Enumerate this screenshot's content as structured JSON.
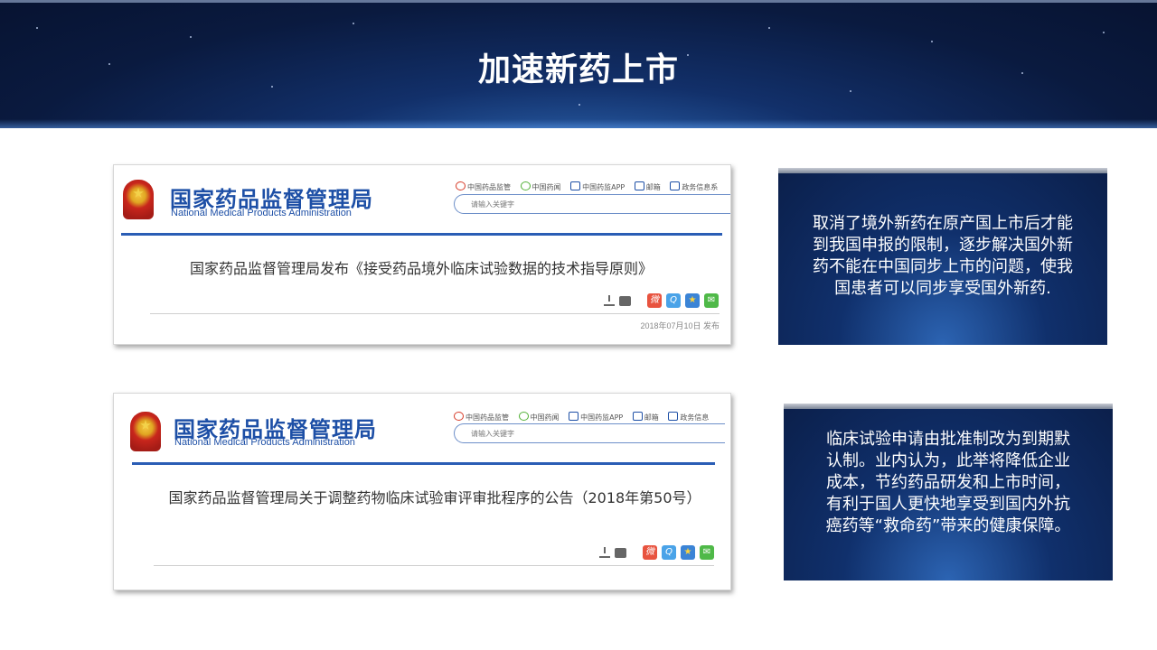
{
  "slide": {
    "title": "加速新药上市"
  },
  "cards": [
    {
      "org_cn": "国家药品监督管理局",
      "org_en": "National Medical Products Administration",
      "links": [
        "中国药品监管",
        "中国药闻",
        "中国药监APP",
        "邮箱",
        "政务信息系"
      ],
      "search_placeholder": "请输入关键字",
      "headline": "国家药品监督管理局发布《接受药品境外临床试验数据的技术指导原则》",
      "date": "2018年07月10日 发布"
    },
    {
      "org_cn": "国家药品监督管理局",
      "org_en": "National Medical Products Administration",
      "links": [
        "中国药品监管",
        "中国药闻",
        "中国药监APP",
        "邮箱",
        "政务信息"
      ],
      "search_placeholder": "请输入关键字",
      "headline": "国家药品监督管理局关于调整药物临床试验审评审批程序的公告（2018年第50号）"
    }
  ],
  "info_boxes": [
    {
      "text": "取消了境外新药在原产国上市后才能到我国申报的限制，逐步解决国外新药不能在中国同步上市的问题，使我国患者可以同步享受国外新药."
    },
    {
      "text": "临床试验申请由批准制改为到期默认制。业内认为，此举将降低企业成本，节约药品研发和上市时间，有利于国人更快地享受到国内外抗癌药等“救命药”带来的健康保障。"
    }
  ],
  "colors": {
    "banner": "#0a1a3f",
    "brand_blue": "#1d4fa6",
    "info_box": "#10306c"
  },
  "icons": [
    "weibo-icon",
    "wechat-icon",
    "phone-icon",
    "mail-icon",
    "monitor-icon",
    "download-icon",
    "print-icon",
    "qq-share-icon",
    "favorite-icon",
    "wechat-share-icon"
  ]
}
